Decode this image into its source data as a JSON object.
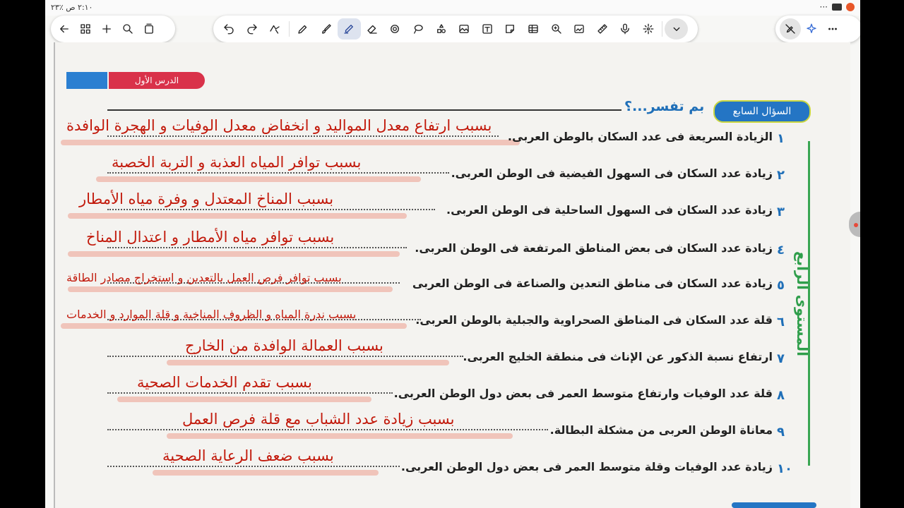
{
  "status_bar": {
    "time_battery": "٢:١٠ ص ٪٢٣",
    "more": "···"
  },
  "nav_toolbar": {
    "icons": [
      "back-arrow-icon",
      "grid-icon",
      "plus-icon",
      "search-icon",
      "pages-icon"
    ]
  },
  "tool_toolbar": {
    "icons": [
      "undo-icon",
      "redo-icon",
      "lasso-icon",
      "pen-icon",
      "brush-icon",
      "highlighter-icon",
      "eraser-icon",
      "shapes-icon",
      "lasso-select-icon",
      "element-icon",
      "image-icon",
      "text-icon",
      "sticky-note-icon",
      "table-icon",
      "zoom-icon",
      "media-icon",
      "ruler-icon",
      "mic-icon",
      "laser-icon",
      "chevron-down-icon"
    ],
    "active_tool": "highlighter-icon"
  },
  "right_toolbar": {
    "icons": [
      "edit-off-icon",
      "sparkle-icon",
      "more-icon"
    ]
  },
  "page": {
    "lesson_tab": "الدرس الأول",
    "question_badge": "السؤال السابع",
    "question_title": "بم تفسر...؟",
    "level_label": "المستوى الرابع",
    "questions": [
      {
        "num": "١",
        "text": "الزيادة السريعة فى عدد السكان بالوطن العربى.",
        "answer": "بسبب ارتفاع معدل المواليد و انخفاض معدل الوفيات و الهجرة الوافدة"
      },
      {
        "num": "٢",
        "text": "زيادة عدد السكان فى السهول الفيضية فى الوطن العربى.",
        "answer": "بسبب توافر المياه العذبة و التربة الخصبة"
      },
      {
        "num": "٣",
        "text": "زيادة عدد السكان فى السهول الساحلية فى الوطن العربى.",
        "answer": "بسبب المناخ المعتدل و وفرة مياه الأمطار"
      },
      {
        "num": "٤",
        "text": "زيادة عدد السكان فى بعض المناطق المرتفعة فى الوطن العربى.",
        "answer": "بسبب توافر مياه الأمطار و اعتدال المناخ"
      },
      {
        "num": "٥",
        "text": "زيادة عدد السكان فى مناطق التعدين والصناعة فى الوطن العربى",
        "answer": "بسبب توافر فرص العمل بالتعدين و استخراج مصادر الطاقة"
      },
      {
        "num": "٦",
        "text": "قلة عدد السكان فى المناطق الصحراوية والجبلية بالوطن العربى.",
        "answer": "بسبب ندرة المياه و الظروف المناخية و قلة الموارد و الخدمات"
      },
      {
        "num": "٧",
        "text": "ارتفاع نسبة الذكور عن الإناث فى منطقة الخليج العربى.",
        "answer": "بسبب العمالة الوافدة من الخارج"
      },
      {
        "num": "٨",
        "text": "قلة عدد الوفيات وارتفاع متوسط العمر فى بعض دول الوطن العربى.",
        "answer": "بسبب تقدم الخدمات الصحية"
      },
      {
        "num": "٩",
        "text": "معاناة الوطن العربى من مشكلة البطالة.",
        "answer": "بسبب زيادة عدد الشباب مع قلة فرص العمل"
      },
      {
        "num": "١٠",
        "text": "زيادة عدد الوفيات وقلة متوسط العمر فى بعض دول الوطن العربى.",
        "answer": "بسبب ضعف الرعاية الصحية"
      }
    ]
  }
}
